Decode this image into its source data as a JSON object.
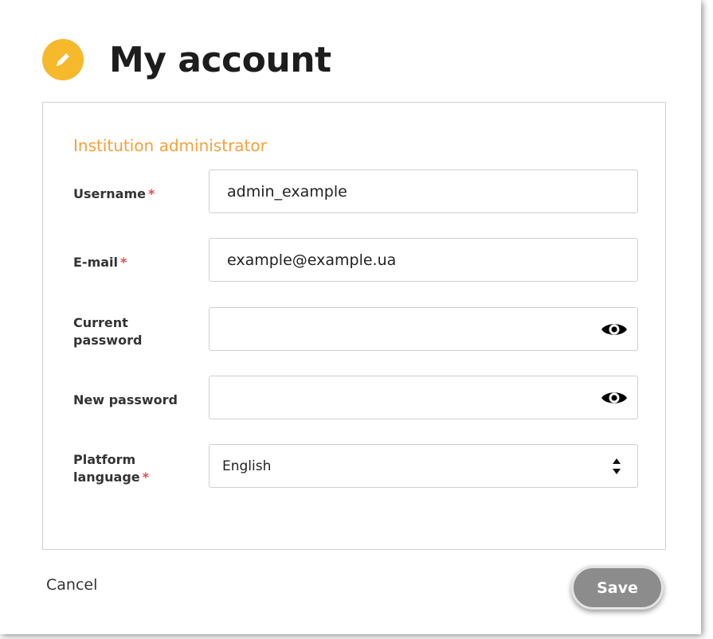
{
  "header": {
    "title": "My account",
    "icon": "pencil-icon",
    "accent": "#f6b92b"
  },
  "section": {
    "heading": "Institution administrator",
    "heading_color": "#f2a23a"
  },
  "fields": {
    "username": {
      "label": "Username",
      "required": "*",
      "value": "admin_example"
    },
    "email": {
      "label": "E-mail",
      "required": "*",
      "value": "example@example.ua"
    },
    "current_password": {
      "label_line1": "Current",
      "label_line2": "password",
      "value": "",
      "icon": "eye-icon"
    },
    "new_password": {
      "label": "New password",
      "value": "",
      "icon": "eye-icon"
    },
    "language": {
      "label_line1": "Platform",
      "label_line2": "language",
      "required": "*",
      "selected": "English",
      "icon": "select-arrows-icon"
    }
  },
  "actions": {
    "cancel_label": "Cancel",
    "save_label": "Save",
    "save_color": "#8c8c8c"
  }
}
